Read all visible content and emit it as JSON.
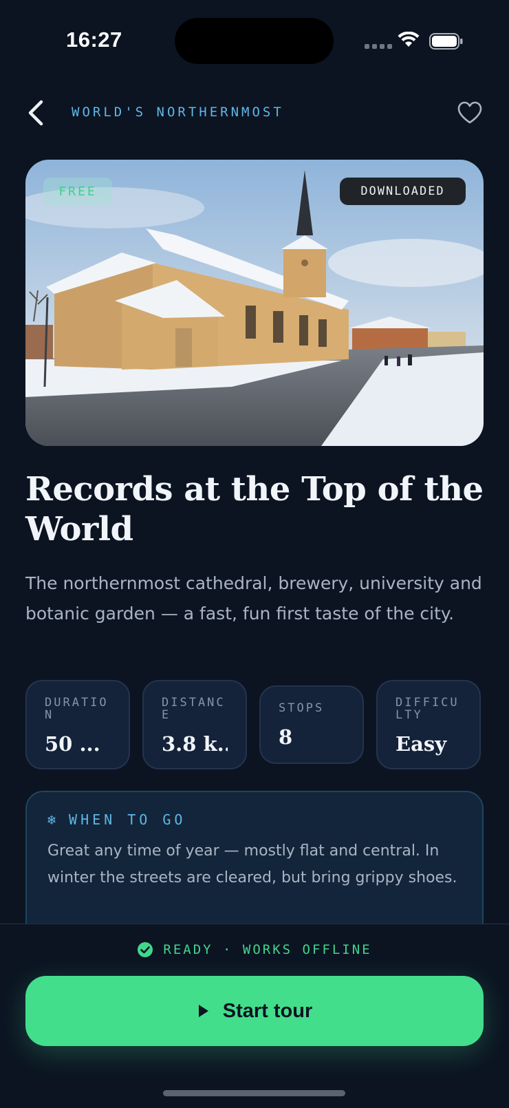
{
  "status_bar": {
    "time": "16:27"
  },
  "header": {
    "title": "WORLD'S NORTHERNMOST"
  },
  "hero": {
    "badge_free": "FREE",
    "badge_downloaded": "DOWNLOADED"
  },
  "tour": {
    "title": "Records at the Top of the World",
    "description": "The northernmost cathedral, brewery, university and botanic garden — a fast, fun first taste of the city."
  },
  "stats": [
    {
      "label": "DURATION",
      "value": "50 ..."
    },
    {
      "label": "DISTANCE",
      "value": "3.8 k..."
    },
    {
      "label": "STOPS",
      "value": "8"
    },
    {
      "label": "DIFFICULTY",
      "value": "Easy"
    }
  ],
  "when_to_go": {
    "heading": "WHEN TO GO",
    "text": "Great any time of year — mostly flat and central. In winter the streets are cleared, but bring grippy shoes."
  },
  "footer": {
    "status": "READY · WORKS OFFLINE",
    "start_button": "Start tour"
  },
  "colors": {
    "accent_green": "#43de8c",
    "accent_blue": "#5fb7e6",
    "background": "#0c1422"
  }
}
